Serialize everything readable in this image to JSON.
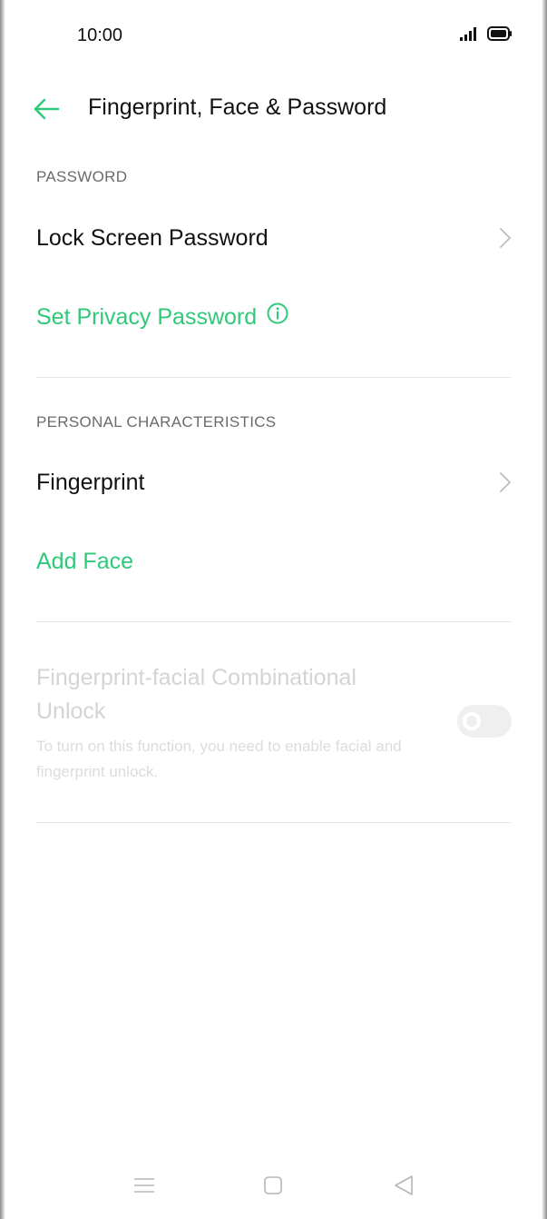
{
  "status_bar": {
    "time": "10:00",
    "icons": [
      "signal-icon",
      "battery-icon"
    ]
  },
  "header": {
    "back_icon": "back-arrow-icon",
    "title": "Fingerprint, Face & Password"
  },
  "sections": {
    "password": {
      "header": "PASSWORD",
      "lock_screen_password": "Lock Screen Password",
      "set_privacy_password": "Set Privacy Password"
    },
    "personal": {
      "header": "PERSONAL CHARACTERISTICS",
      "fingerprint": "Fingerprint",
      "add_face": "Add Face"
    },
    "combination": {
      "title": "Fingerprint-facial Combinational Unlock",
      "description": "To turn on this function, you need to enable facial and fingerprint unlock.",
      "toggle_on": false,
      "enabled": false
    }
  },
  "nav_bar": {
    "buttons": [
      "menu-icon",
      "home-icon",
      "back-icon"
    ]
  },
  "colors": {
    "accent": "#2fc97a",
    "text": "#111111",
    "section_header": "#6b6b6b",
    "disabled_text": "#d4d4d4",
    "divider": "#e6e6e6"
  }
}
